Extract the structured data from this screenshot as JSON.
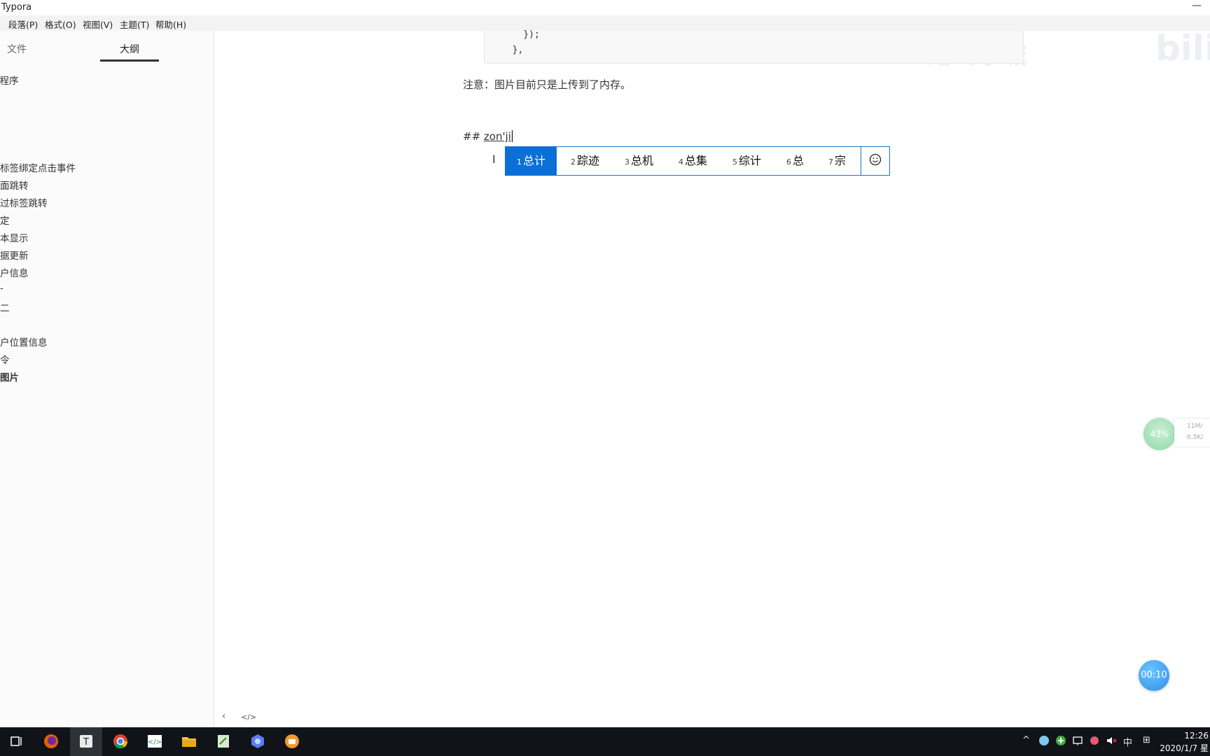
{
  "window": {
    "title": "Typora",
    "minimize_glyph": "—"
  },
  "menu": [
    "段落(P)",
    "格式(O)",
    "视图(V)",
    "主题(T)",
    "帮助(H)"
  ],
  "sidebar": {
    "tabs": [
      "文件",
      "大纲"
    ],
    "active_tab": "大纲",
    "outline": [
      "小程序",
      "标签绑定点击事件",
      "面跳转",
      "过标签跳转",
      "定",
      "本显示",
      "据更新",
      "户信息",
      "-",
      "二",
      "户位置信息",
      "令",
      "图片"
    ]
  },
  "editor": {
    "code_lines": [
      "    });",
      "  },"
    ],
    "paragraph": "注意：图片目前只是上传到了内存。",
    "heading_prefix": "## ",
    "composition": "zon'ji",
    "bottom": {
      "outline_toggle": "‹",
      "source_toggle": "</>"
    }
  },
  "ime": {
    "candidates": [
      {
        "num": "1",
        "text": "总计"
      },
      {
        "num": "2",
        "text": "踪迹"
      },
      {
        "num": "3",
        "text": "总机"
      },
      {
        "num": "4",
        "text": "总集"
      },
      {
        "num": "5",
        "text": "综计"
      },
      {
        "num": "6",
        "text": "总"
      },
      {
        "num": "7",
        "text": "宗"
      }
    ],
    "selected_index": 0,
    "emoji_icon": "smiley-icon",
    "accent": "#0a6fd6"
  },
  "overlays": {
    "watermark": "路飞学城",
    "gauge_percent": "43%",
    "net_up": "11M/",
    "net_down": "6.5K/",
    "timer": "00:10"
  },
  "taskbar": {
    "apps": [
      "task-view-icon",
      "firefox-icon",
      "typora-icon",
      "chrome-icon",
      "code-editor-icon",
      "file-explorer-icon",
      "notepad-icon",
      "app-icon",
      "app-orange-icon"
    ],
    "tray": {
      "caret": "^",
      "ime_mode": "中",
      "grid": "⊞"
    },
    "time": "12:26",
    "date": "2020/1/7 星"
  }
}
